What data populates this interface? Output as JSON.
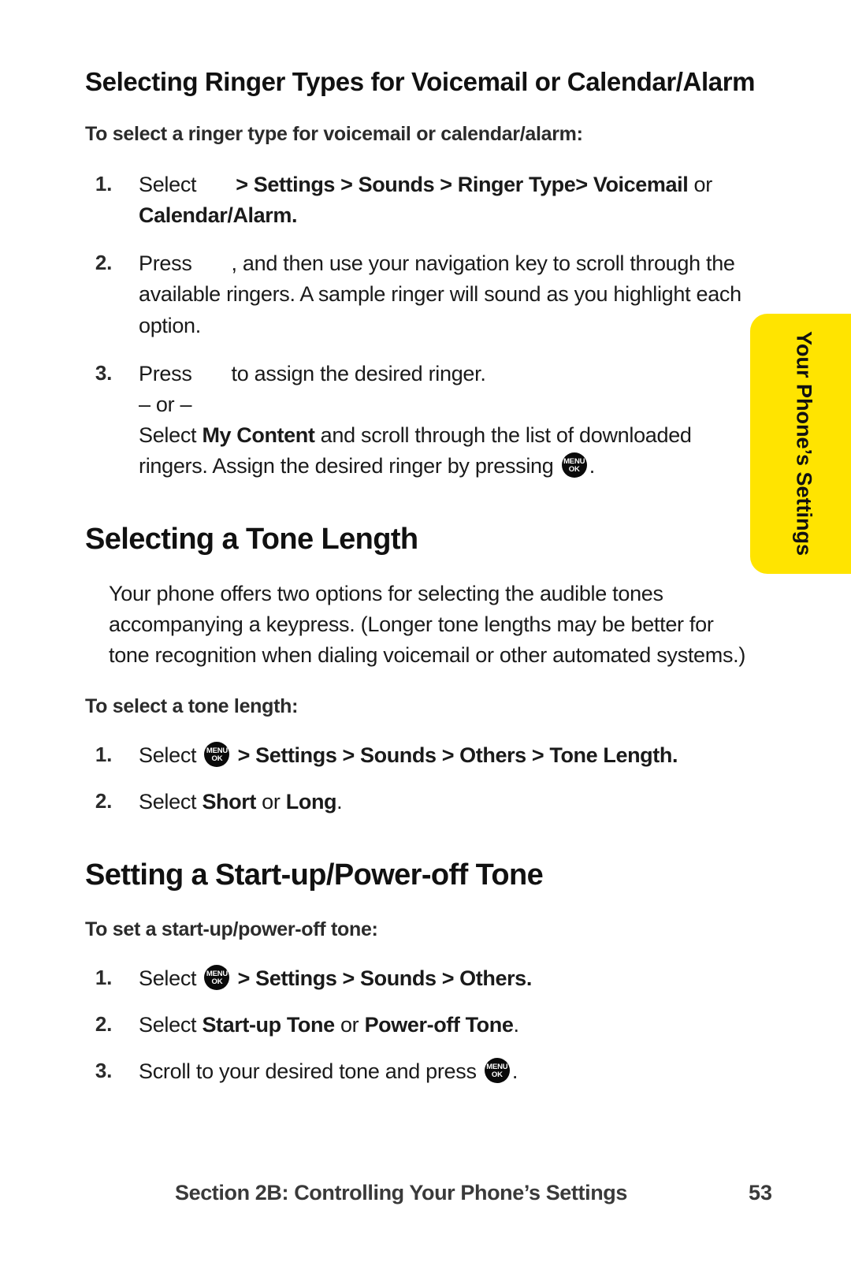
{
  "side_tab": {
    "label": "Your Phone’s Settings",
    "color": "#FFE400"
  },
  "sections": [
    {
      "heading": "Selecting Ringer Types for Voicemail or Calendar/Alarm",
      "lead": "To select a ringer type for voicemail or calendar/alarm:",
      "steps": {
        "n1": "1.",
        "s1_a": "Select",
        "s1_b": "> Settings > Sounds > Ringer Type> Voicemail",
        "s1_c": "or",
        "s1_d": "Calendar/Alarm",
        "s1_e": ".",
        "n2": "2.",
        "s2_a": "Press",
        "s2_b": ", and then use your navigation key to scroll through the available ringers. A sample ringer will sound as you highlight each option.",
        "n3": "3.",
        "s3_a": "Press",
        "s3_b": "to assign the desired ringer.",
        "s3_or": "– or –",
        "s3_c": "Select",
        "s3_d": "My Content",
        "s3_e": "and scroll through the list of downloaded ringers. Assign the desired ringer by pressing",
        "s3_f": "."
      }
    },
    {
      "heading": "Selecting a Tone Length",
      "body": "Your phone offers two options for selecting the audible tones accompanying a keypress. (Longer tone lengths may be better for tone recognition when dialing voicemail or other automated systems.)",
      "lead": "To select a tone length:",
      "steps": {
        "n1": "1.",
        "s1_a": "Select",
        "s1_b": "> Settings > Sounds > Others > Tone Length",
        "s1_c": ".",
        "n2": "2.",
        "s2_a": "Select",
        "s2_b": "Short",
        "s2_c": "or",
        "s2_d": "Long",
        "s2_e": "."
      }
    },
    {
      "heading": "Setting a Start-up/Power-off Tone",
      "lead": "To set a start-up/power-off tone:",
      "steps": {
        "n1": "1.",
        "s1_a": "Select",
        "s1_b": "> Settings > Sounds > Others",
        "s1_c": ".",
        "n2": "2.",
        "s2_a": "Select",
        "s2_b": "Start-up Tone",
        "s2_c": "or",
        "s2_d": "Power-off Tone",
        "s2_e": ".",
        "n3": "3.",
        "s3_a": "Scroll to your desired tone and press",
        "s3_b": "."
      }
    }
  ],
  "icons": {
    "menu_ok_top": "MENU",
    "menu_ok_bottom": "OK"
  },
  "footer": {
    "text": "Section 2B: Controlling Your Phone’s Settings",
    "page": "53"
  }
}
